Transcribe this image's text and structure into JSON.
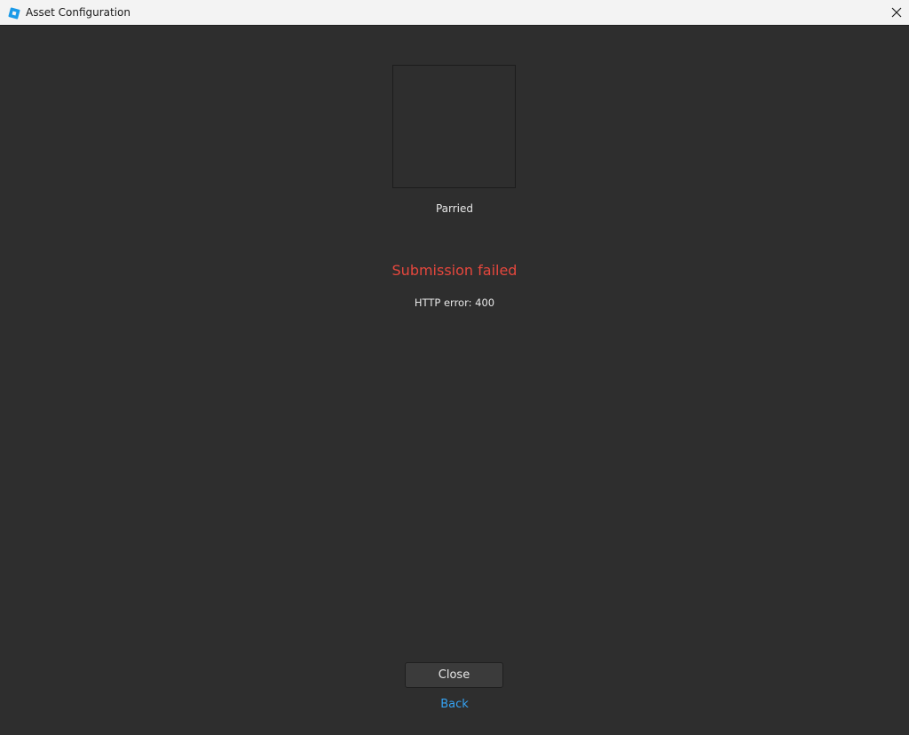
{
  "window": {
    "title": "Asset Configuration",
    "app_icon": "roblox-studio-icon",
    "close_icon": "close-icon"
  },
  "asset": {
    "name": "Parried"
  },
  "status": {
    "title": "Submission failed",
    "detail": "HTTP error: 400",
    "title_color": "#e5473d"
  },
  "actions": {
    "close_label": "Close",
    "back_label": "Back",
    "link_color": "#35a2f2"
  }
}
